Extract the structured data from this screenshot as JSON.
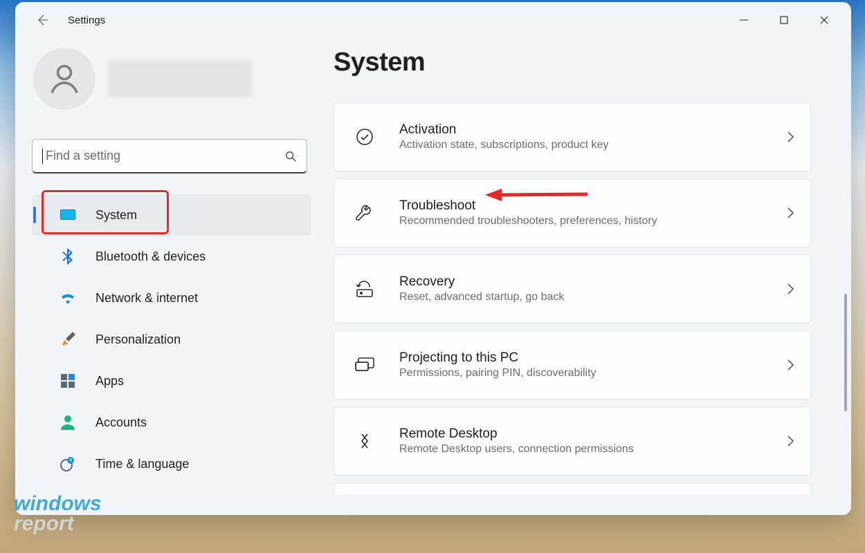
{
  "app_title": "Settings",
  "search": {
    "placeholder": "Find a setting"
  },
  "sidebar": {
    "items": [
      {
        "label": "System",
        "selected": true
      },
      {
        "label": "Bluetooth & devices",
        "selected": false
      },
      {
        "label": "Network & internet",
        "selected": false
      },
      {
        "label": "Personalization",
        "selected": false
      },
      {
        "label": "Apps",
        "selected": false
      },
      {
        "label": "Accounts",
        "selected": false
      },
      {
        "label": "Time & language",
        "selected": false
      }
    ]
  },
  "main": {
    "title": "System",
    "cards": [
      {
        "title": "Activation",
        "sub": "Activation state, subscriptions, product key"
      },
      {
        "title": "Troubleshoot",
        "sub": "Recommended troubleshooters, preferences, history"
      },
      {
        "title": "Recovery",
        "sub": "Reset, advanced startup, go back"
      },
      {
        "title": "Projecting to this PC",
        "sub": "Permissions, pairing PIN, discoverability"
      },
      {
        "title": "Remote Desktop",
        "sub": "Remote Desktop users, connection permissions"
      }
    ]
  },
  "annotations": {
    "highlighted_nav_index": 0,
    "arrow_target_card_index": 1
  },
  "watermark": {
    "line1": "windows",
    "line2": "report"
  }
}
